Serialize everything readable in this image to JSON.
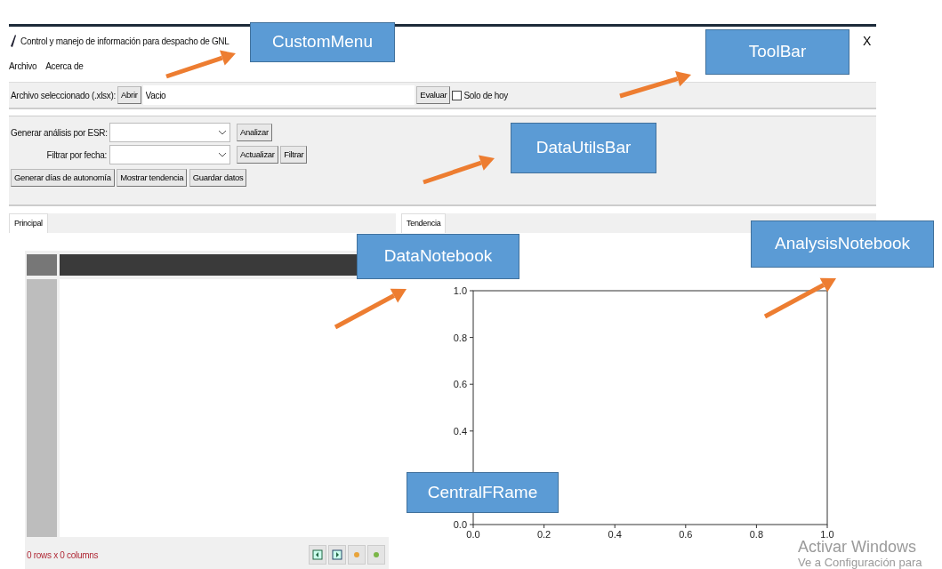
{
  "window": {
    "title": "Control y manejo de información para despacho de GNL",
    "close": "X"
  },
  "menu": [
    "Archivo",
    "Acerca de"
  ],
  "toolbar": {
    "label": "Archivo seleccionado (.xlsx):",
    "open_button": "Abrir",
    "file_value": "Vacio",
    "evaluate_button": "Evaluar",
    "checkbox": {
      "label": "Solo de hoy",
      "checked": false
    }
  },
  "data_utils": {
    "esr_label": "Generar análisis por ESR:",
    "analyze_button": "Analizar",
    "date_label": "Filtrar por fecha:",
    "update_button": "Actualizar",
    "filter_button": "Filtrar",
    "autonomy_button": "Generar días de autonomía",
    "trend_button": "Mostrar tendencia",
    "save_button": "Guardar datos"
  },
  "data_notebook": {
    "tabs": [
      {
        "label": "Principal",
        "selected": true
      }
    ],
    "table_status": "0 rows x 0 columns"
  },
  "analysis_notebook": {
    "tabs": [
      {
        "label": "Tendencia",
        "selected": true
      }
    ],
    "chart_data": {
      "type": "line",
      "xlim": [
        0,
        1
      ],
      "ylim": [
        0,
        1
      ],
      "xticks": [
        {
          "value": 0,
          "label": "0.0"
        },
        {
          "value": 0.2,
          "label": "0.2"
        },
        {
          "value": 0.4,
          "label": "0.4"
        },
        {
          "value": 0.6,
          "label": "0.6"
        },
        {
          "value": 0.8,
          "label": "0.8"
        },
        {
          "value": 1,
          "label": "1.0"
        }
      ],
      "yticks": [
        {
          "value": 0,
          "label": "0.0"
        },
        {
          "value": 0.4,
          "label": "0.4"
        },
        {
          "value": 0.6,
          "label": "0.6"
        },
        {
          "value": 0.8,
          "label": "0.8"
        },
        {
          "value": 1,
          "label": "1.0"
        }
      ]
    }
  },
  "annotations": [
    "CustomMenu",
    "ToolBar",
    "DataUtilsBar",
    "DataNotebook",
    "AnalysisNotebook",
    "CentralFRame"
  ],
  "activation_notice": [
    "Activar Windows",
    "Ve a Configuración para"
  ]
}
